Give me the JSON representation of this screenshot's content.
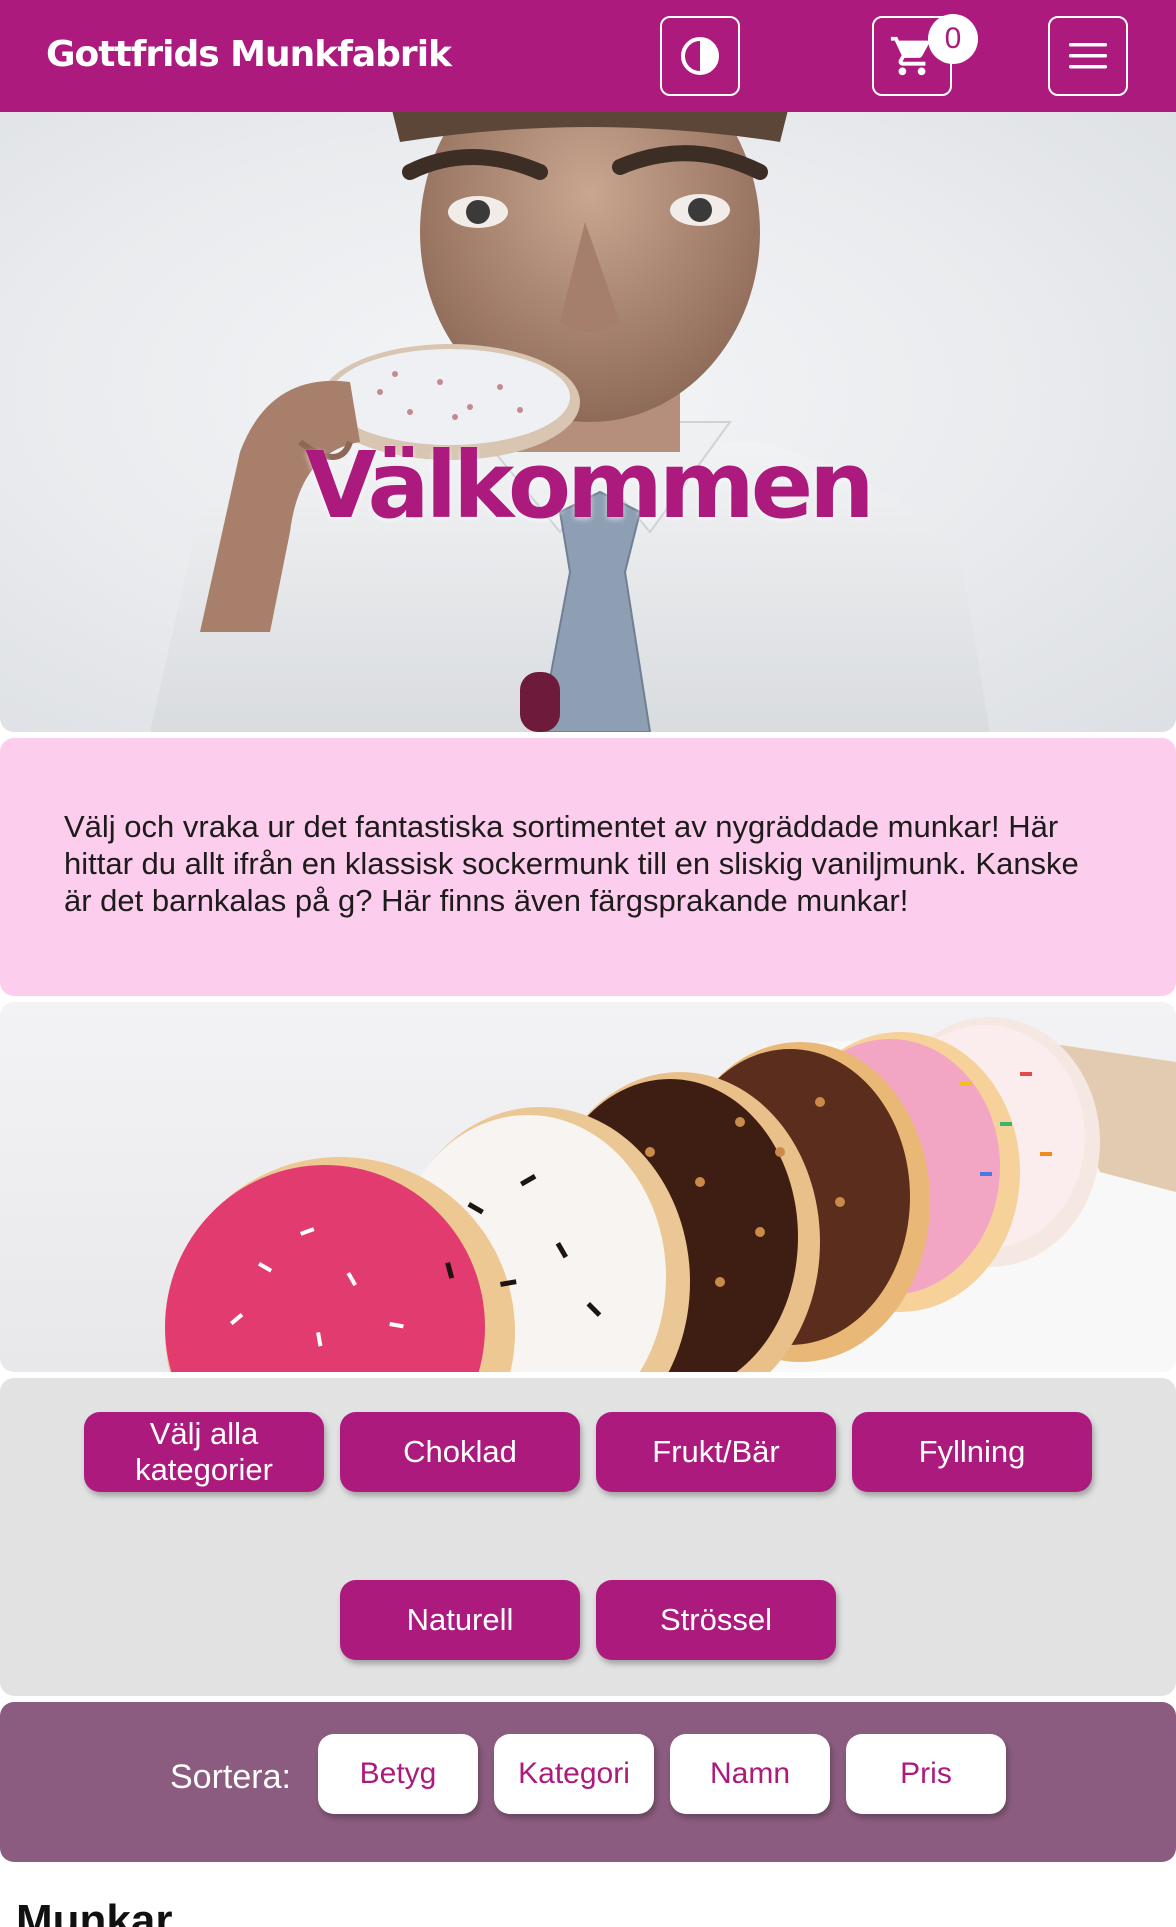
{
  "header": {
    "brand": "Gottfrids Munkfabrik",
    "cart_count": "0"
  },
  "hero": {
    "title": "Välkommen"
  },
  "intro": {
    "text": "Välj och vraka ur det fantastiska sortimentet av nygräddade munkar! Här hittar du allt ifrån en klassisk sockermunk till en sliskig vaniljmunk. Kanske är det barnkalas på g? Här finns även färgsprakande munkar!"
  },
  "categories": [
    {
      "label": "Välj alla kategorier"
    },
    {
      "label": "Choklad"
    },
    {
      "label": "Frukt/Bär"
    },
    {
      "label": "Fyllning"
    },
    {
      "label": "Naturell"
    },
    {
      "label": "Strössel"
    }
  ],
  "sort": {
    "label": "Sortera:",
    "options": [
      "Betyg",
      "Kategori",
      "Namn",
      "Pris"
    ]
  },
  "products": {
    "heading": "Munkar"
  },
  "colors": {
    "primary": "#ac1a7e",
    "intro_bg": "#fccdec",
    "categories_bg": "#e2e2e2",
    "sort_bg": "#8b5c7f"
  },
  "icons": {
    "contrast": "contrast-icon",
    "cart": "cart-icon",
    "menu": "hamburger-menu-icon"
  }
}
